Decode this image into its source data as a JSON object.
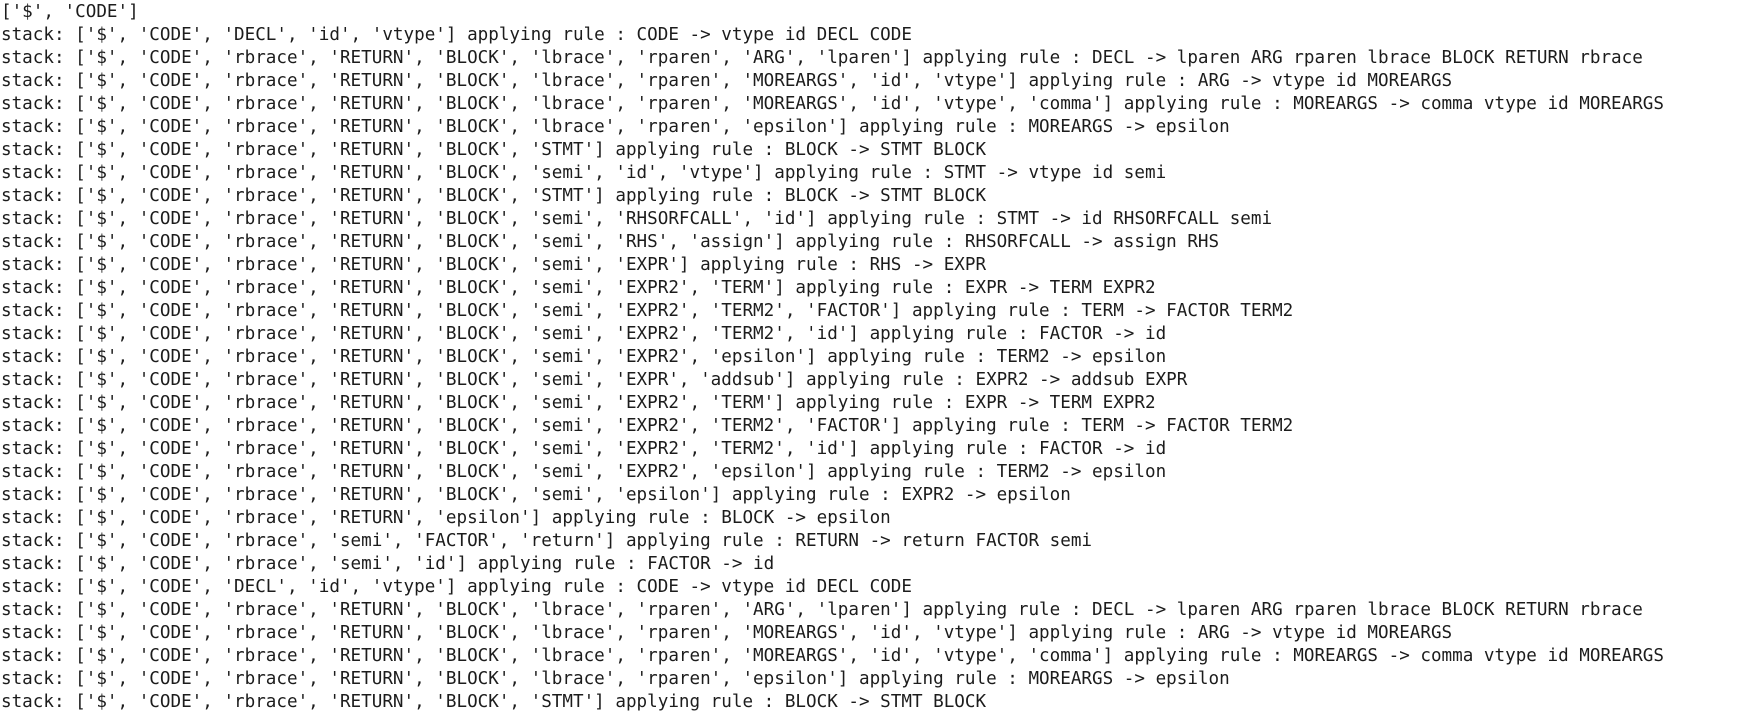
{
  "terminal": {
    "lines": [
      "['$', 'CODE']",
      "stack: ['$', 'CODE', 'DECL', 'id', 'vtype'] applying rule : CODE -> vtype id DECL CODE",
      "stack: ['$', 'CODE', 'rbrace', 'RETURN', 'BLOCK', 'lbrace', 'rparen', 'ARG', 'lparen'] applying rule : DECL -> lparen ARG rparen lbrace BLOCK RETURN rbrace",
      "stack: ['$', 'CODE', 'rbrace', 'RETURN', 'BLOCK', 'lbrace', 'rparen', 'MOREARGS', 'id', 'vtype'] applying rule : ARG -> vtype id MOREARGS",
      "stack: ['$', 'CODE', 'rbrace', 'RETURN', 'BLOCK', 'lbrace', 'rparen', 'MOREARGS', 'id', 'vtype', 'comma'] applying rule : MOREARGS -> comma vtype id MOREARGS",
      "stack: ['$', 'CODE', 'rbrace', 'RETURN', 'BLOCK', 'lbrace', 'rparen', 'epsilon'] applying rule : MOREARGS -> epsilon",
      "stack: ['$', 'CODE', 'rbrace', 'RETURN', 'BLOCK', 'STMT'] applying rule : BLOCK -> STMT BLOCK",
      "stack: ['$', 'CODE', 'rbrace', 'RETURN', 'BLOCK', 'semi', 'id', 'vtype'] applying rule : STMT -> vtype id semi",
      "stack: ['$', 'CODE', 'rbrace', 'RETURN', 'BLOCK', 'STMT'] applying rule : BLOCK -> STMT BLOCK",
      "stack: ['$', 'CODE', 'rbrace', 'RETURN', 'BLOCK', 'semi', 'RHSORFCALL', 'id'] applying rule : STMT -> id RHSORFCALL semi",
      "stack: ['$', 'CODE', 'rbrace', 'RETURN', 'BLOCK', 'semi', 'RHS', 'assign'] applying rule : RHSORFCALL -> assign RHS",
      "stack: ['$', 'CODE', 'rbrace', 'RETURN', 'BLOCK', 'semi', 'EXPR'] applying rule : RHS -> EXPR",
      "stack: ['$', 'CODE', 'rbrace', 'RETURN', 'BLOCK', 'semi', 'EXPR2', 'TERM'] applying rule : EXPR -> TERM EXPR2",
      "stack: ['$', 'CODE', 'rbrace', 'RETURN', 'BLOCK', 'semi', 'EXPR2', 'TERM2', 'FACTOR'] applying rule : TERM -> FACTOR TERM2",
      "stack: ['$', 'CODE', 'rbrace', 'RETURN', 'BLOCK', 'semi', 'EXPR2', 'TERM2', 'id'] applying rule : FACTOR -> id",
      "stack: ['$', 'CODE', 'rbrace', 'RETURN', 'BLOCK', 'semi', 'EXPR2', 'epsilon'] applying rule : TERM2 -> epsilon",
      "stack: ['$', 'CODE', 'rbrace', 'RETURN', 'BLOCK', 'semi', 'EXPR', 'addsub'] applying rule : EXPR2 -> addsub EXPR",
      "stack: ['$', 'CODE', 'rbrace', 'RETURN', 'BLOCK', 'semi', 'EXPR2', 'TERM'] applying rule : EXPR -> TERM EXPR2",
      "stack: ['$', 'CODE', 'rbrace', 'RETURN', 'BLOCK', 'semi', 'EXPR2', 'TERM2', 'FACTOR'] applying rule : TERM -> FACTOR TERM2",
      "stack: ['$', 'CODE', 'rbrace', 'RETURN', 'BLOCK', 'semi', 'EXPR2', 'TERM2', 'id'] applying rule : FACTOR -> id",
      "stack: ['$', 'CODE', 'rbrace', 'RETURN', 'BLOCK', 'semi', 'EXPR2', 'epsilon'] applying rule : TERM2 -> epsilon",
      "stack: ['$', 'CODE', 'rbrace', 'RETURN', 'BLOCK', 'semi', 'epsilon'] applying rule : EXPR2 -> epsilon",
      "stack: ['$', 'CODE', 'rbrace', 'RETURN', 'epsilon'] applying rule : BLOCK -> epsilon",
      "stack: ['$', 'CODE', 'rbrace', 'semi', 'FACTOR', 'return'] applying rule : RETURN -> return FACTOR semi",
      "stack: ['$', 'CODE', 'rbrace', 'semi', 'id'] applying rule : FACTOR -> id",
      "stack: ['$', 'CODE', 'DECL', 'id', 'vtype'] applying rule : CODE -> vtype id DECL CODE",
      "stack: ['$', 'CODE', 'rbrace', 'RETURN', 'BLOCK', 'lbrace', 'rparen', 'ARG', 'lparen'] applying rule : DECL -> lparen ARG rparen lbrace BLOCK RETURN rbrace",
      "stack: ['$', 'CODE', 'rbrace', 'RETURN', 'BLOCK', 'lbrace', 'rparen', 'MOREARGS', 'id', 'vtype'] applying rule : ARG -> vtype id MOREARGS",
      "stack: ['$', 'CODE', 'rbrace', 'RETURN', 'BLOCK', 'lbrace', 'rparen', 'MOREARGS', 'id', 'vtype', 'comma'] applying rule : MOREARGS -> comma vtype id MOREARGS",
      "stack: ['$', 'CODE', 'rbrace', 'RETURN', 'BLOCK', 'lbrace', 'rparen', 'epsilon'] applying rule : MOREARGS -> epsilon",
      "stack: ['$', 'CODE', 'rbrace', 'RETURN', 'BLOCK', 'STMT'] applying rule : BLOCK -> STMT BLOCK"
    ]
  }
}
